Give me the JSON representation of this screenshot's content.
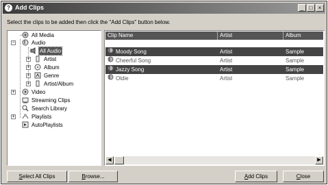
{
  "window": {
    "title": "Add Clips",
    "app_icon_glyph": "?",
    "minimize_glyph": "_",
    "maximize_glyph": "□",
    "close_glyph": "×"
  },
  "instructions": "Select the clips to be added then click the \"Add Clips\" button below.",
  "tree": {
    "items": [
      {
        "label": "All Media",
        "icon": "all-media-icon"
      },
      {
        "label": "Audio",
        "icon": "audio-icon",
        "expander": "−"
      },
      {
        "label": "All Audio",
        "icon": "speaker-icon",
        "selected": true
      },
      {
        "label": "Artist",
        "icon": "artist-icon",
        "expander": "+"
      },
      {
        "label": "Album",
        "icon": "album-icon",
        "expander": "+"
      },
      {
        "label": "Genre",
        "icon": "genre-icon",
        "expander": "+"
      },
      {
        "label": "Artist/Album",
        "icon": "artist-album-icon",
        "expander": "+"
      },
      {
        "label": "Video",
        "icon": "video-icon",
        "expander": "+"
      },
      {
        "label": "Streaming Clips",
        "icon": "streaming-icon"
      },
      {
        "label": "Search Library",
        "icon": "search-icon"
      },
      {
        "label": "Playlists",
        "icon": "playlists-icon",
        "expander": "+"
      },
      {
        "label": "AutoPlaylists",
        "icon": "autoplaylists-icon"
      }
    ]
  },
  "list": {
    "columns": [
      "Clip Name",
      "Artist",
      "Album"
    ],
    "rows": [
      {
        "name": "Moody Song",
        "artist": "Artist",
        "album": "Sample",
        "selected": true
      },
      {
        "name": "Cheerful Song",
        "artist": "Artist",
        "album": "Sample",
        "selected": false
      },
      {
        "name": "Jazzy Song",
        "artist": "Artist",
        "album": "Sample",
        "selected": true
      },
      {
        "name": "Oldie",
        "artist": "Artist",
        "album": "Sample",
        "selected": false
      }
    ],
    "scroll_left_glyph": "◀",
    "scroll_right_glyph": "▶"
  },
  "buttons": {
    "select_all": {
      "accel": "S",
      "rest": "elect All Clips"
    },
    "browse": {
      "accel": "B",
      "rest": "rowse..."
    },
    "add_clips": {
      "accel": "A",
      "rest": "dd Clips"
    },
    "close": {
      "accel": "C",
      "rest": "lose"
    }
  }
}
